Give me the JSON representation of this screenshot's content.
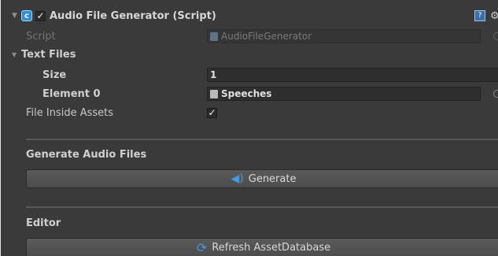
{
  "component": {
    "title": "Audio File Generator (Script)",
    "enabled": true
  },
  "fields": {
    "script": {
      "label": "Script",
      "value": "AudioFileGenerator"
    },
    "text_files": {
      "label": "Text Files",
      "size_label": "Size",
      "size_value": "1",
      "element_label": "Element 0",
      "element_value": "Speeches"
    },
    "file_inside_assets": {
      "label": "File Inside Assets",
      "checked": true
    }
  },
  "sections": {
    "generate": {
      "title": "Generate Audio Files",
      "button_label": "Generate"
    },
    "editor": {
      "title": "Editor",
      "button_label": "Refresh AssetDatabase"
    }
  },
  "icons": {
    "script": "script-icon",
    "help": "help-book-icon",
    "settings": "gear-icon",
    "speaker": "speaker-icon",
    "refresh": "refresh-icon"
  },
  "colors": {
    "accent": "#3f9be8",
    "background": "#3a3a3a"
  }
}
